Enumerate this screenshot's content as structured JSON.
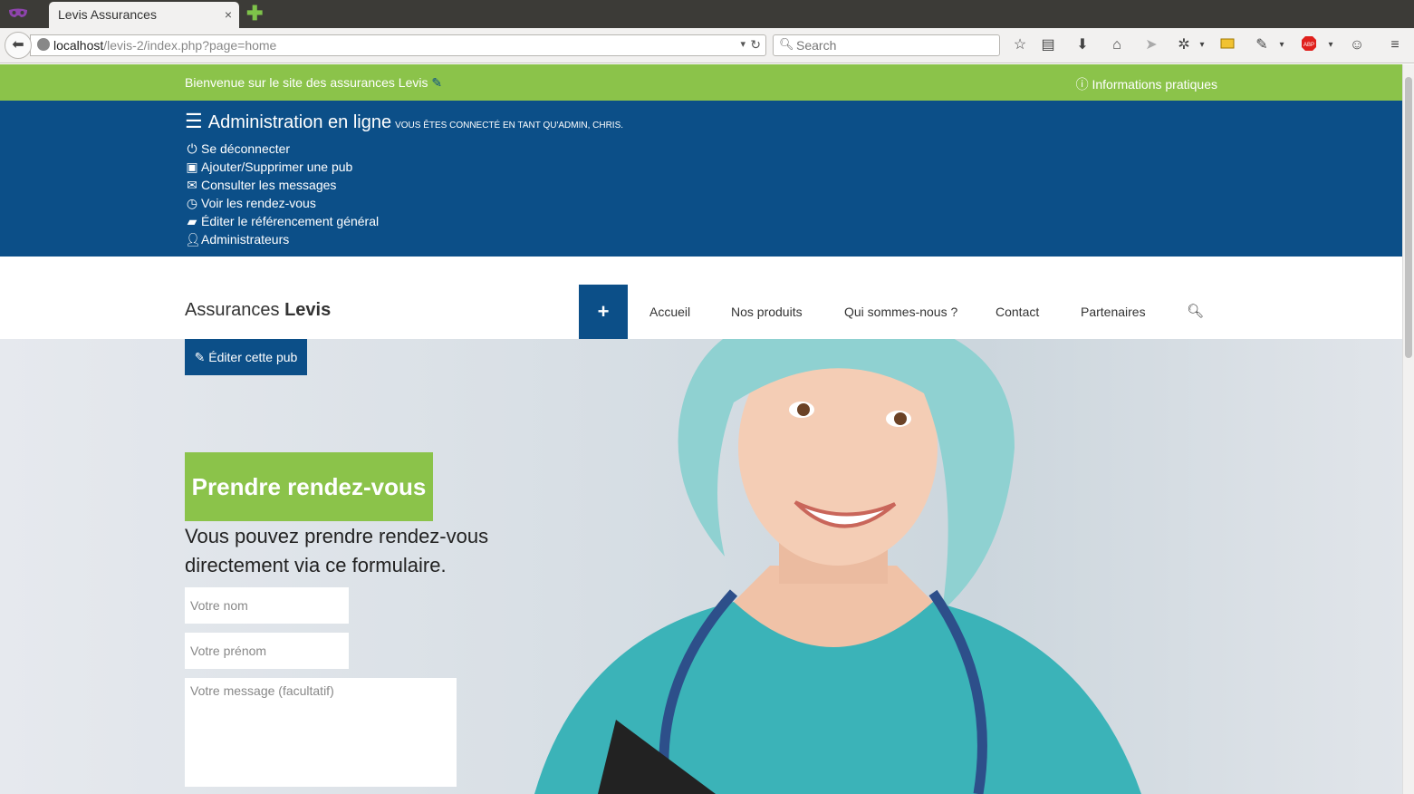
{
  "browser": {
    "tab_title": "Levis Assurances",
    "tab_close": "×",
    "new_tab": "✚",
    "url_host": "localhost",
    "url_path": "/levis-2/index.php?page=home",
    "search_placeholder": "Search",
    "toolbar_icons": [
      "star-icon",
      "reading-list-icon",
      "download-icon",
      "home-icon",
      "share-icon",
      "extension-icon",
      "screenshot-icon",
      "pen-icon",
      "adblock-icon",
      "chat-icon",
      "menu-icon"
    ]
  },
  "topbar": {
    "welcome": "Bienvenue sur le site des assurances Levis",
    "info": "Informations pratiques"
  },
  "admin": {
    "title": "Administration en ligne",
    "connected": "Vous êtes connecté en tant qu'admin, Chris.",
    "menu": [
      {
        "icon": "power-icon",
        "label": "Se déconnecter"
      },
      {
        "icon": "ad-icon",
        "label": "Ajouter/Supprimer une pub"
      },
      {
        "icon": "envelope-icon",
        "label": "Consulter les messages"
      },
      {
        "icon": "clock-icon",
        "label": "Voir les rendez-vous"
      },
      {
        "icon": "briefcase-icon",
        "label": "Éditer le référencement général"
      },
      {
        "icon": "user-icon",
        "label": "Administrateurs"
      }
    ]
  },
  "header": {
    "brand_regular": "Assurances",
    "brand_bold": "Levis",
    "plus": "+",
    "nav": [
      "Accueil",
      "Nos produits",
      "Qui sommes-nous ?",
      "Contact",
      "Partenaires"
    ]
  },
  "hero": {
    "edit_button": "Éditer cette pub",
    "title": "Prendre rendez-vous",
    "description": "Vous pouvez prendre rendez-vous directement via ce formulaire.",
    "name_placeholder": "Votre nom",
    "firstname_placeholder": "Votre prénom",
    "message_placeholder": "Votre message (facultatif)"
  },
  "colors": {
    "green": "#8bc34a",
    "blue": "#0c4f88"
  }
}
